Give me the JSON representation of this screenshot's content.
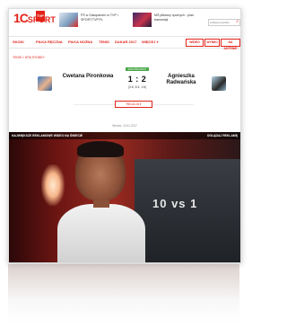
{
  "header": {
    "logo": {
      "number": "1C",
      "word": "SPORT",
      "tv": "TVP"
    },
    "promos": [
      {
        "text": "PŚ w Zakopanem w TVP i SPORT.TVP.PL"
      },
      {
        "text": "MŚ piłkarzy ręcznych - plan transmisji"
      }
    ],
    "search": {
      "placeholder": "szukaj w portalu",
      "icon": "search-icon"
    }
  },
  "nav": {
    "items": [
      "SKOKI",
      "PIŁKA RĘCZNA",
      "PIŁKA NOŻNA",
      "TENIS",
      "DAKAR 2017",
      "WIĘCEJ ▾"
    ],
    "right_items": [
      "WIDEO",
      "WYNIKI",
      "NA ANTENIE"
    ]
  },
  "breadcrumb": "TENIS » WTA SYDNEY",
  "match": {
    "status": "ZAKOŃCZONY",
    "player1": "Cwetana Pironkowa",
    "player2": "Agnieszka Radwańska",
    "score": "1 : 2",
    "sets": "(3:6, 6:4, 1:6)",
    "related_button": "RELACJA ▾",
    "date": "Wtorek, 10.01.2017"
  },
  "video": {
    "left_label": "NAJWIĘKSZE REKLAMOWE WIDEO NA ŚWIECIE",
    "right_label": "OGLĄDAJ REKLAMĘ",
    "overlay_text": "10 vs 1"
  },
  "colors": {
    "accent": "#e2231a",
    "live": "#4aa84a"
  }
}
